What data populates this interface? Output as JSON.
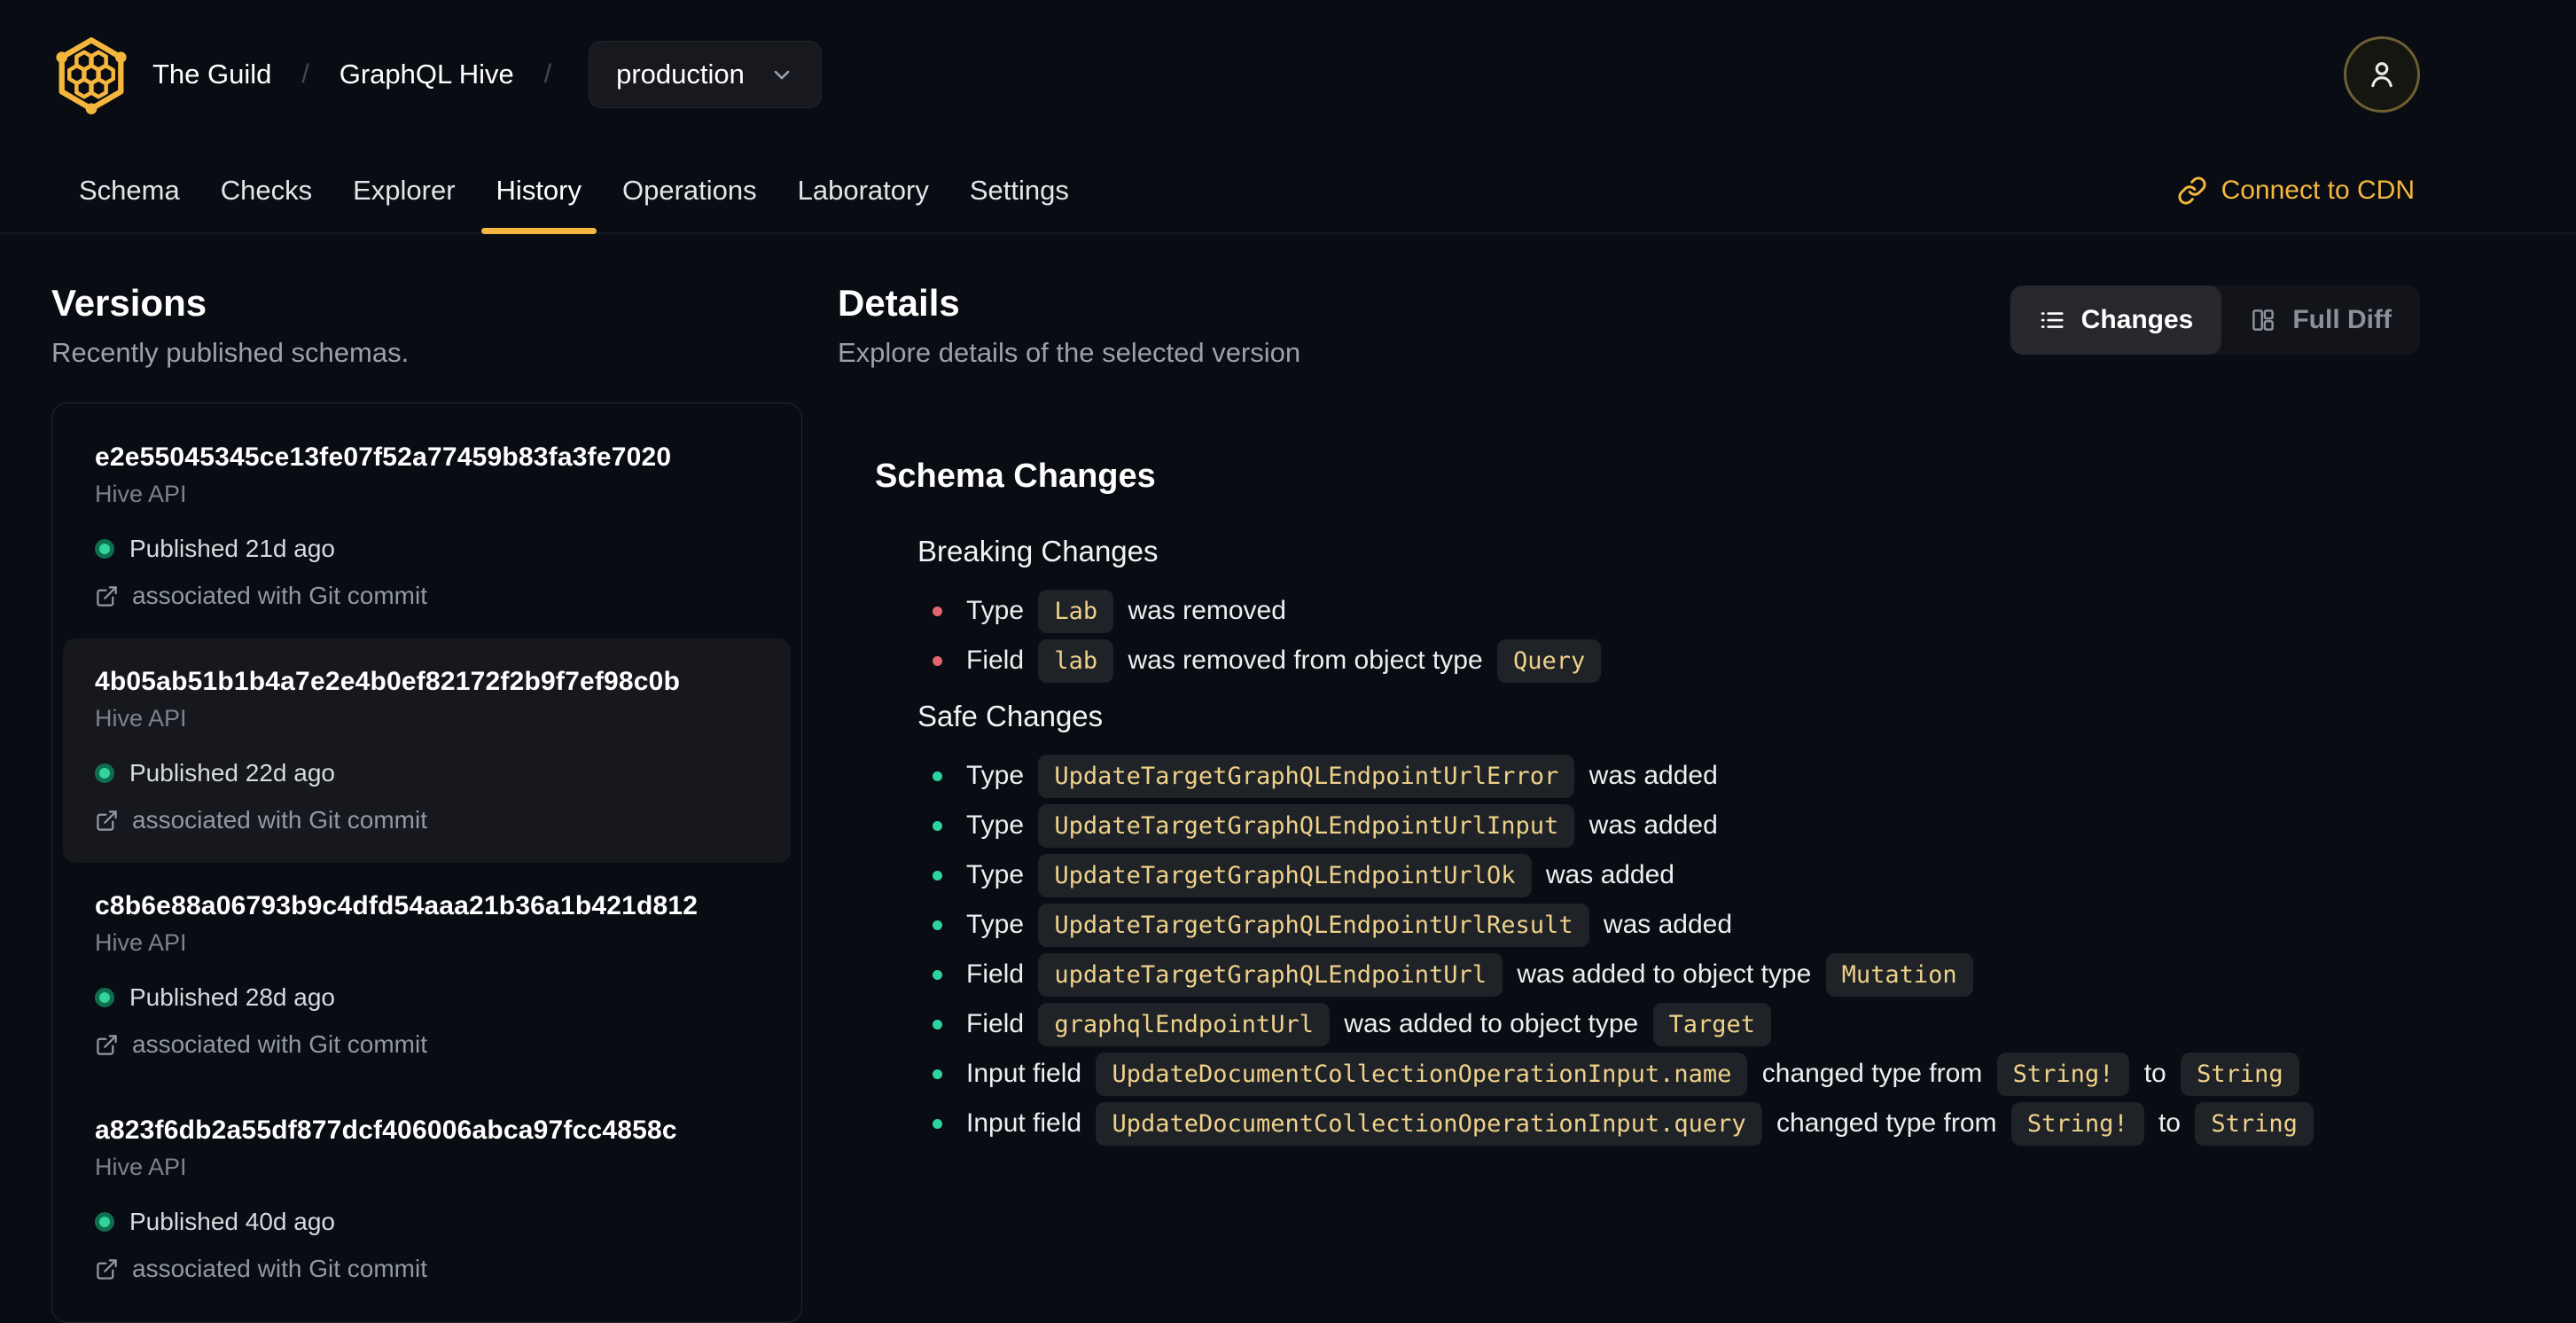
{
  "colors": {
    "accent": "#f4b740",
    "safe_change": "#2dd4a0",
    "breaking_change": "#e56570",
    "published_dot": "#34d399"
  },
  "header": {
    "org": "The Guild",
    "project": "GraphQL Hive",
    "separator": "/",
    "target_selector": {
      "value": "production"
    },
    "connect_cdn_label": "Connect to CDN",
    "tabs": [
      {
        "label": "Schema",
        "active": false
      },
      {
        "label": "Checks",
        "active": false
      },
      {
        "label": "Explorer",
        "active": false
      },
      {
        "label": "History",
        "active": true
      },
      {
        "label": "Operations",
        "active": false
      },
      {
        "label": "Laboratory",
        "active": false
      },
      {
        "label": "Settings",
        "active": false
      }
    ]
  },
  "versions_panel": {
    "title": "Versions",
    "subtitle": "Recently published schemas.",
    "items": [
      {
        "hash": "e2e55045345ce13fe07f52a77459b83fa3fe7020",
        "service": "Hive API",
        "published": "Published 21d ago",
        "git_label": "associated with Git commit",
        "selected": false
      },
      {
        "hash": "4b05ab51b1b4a7e2e4b0ef82172f2b9f7ef98c0b",
        "service": "Hive API",
        "published": "Published 22d ago",
        "git_label": "associated with Git commit",
        "selected": true
      },
      {
        "hash": "c8b6e88a06793b9c4dfd54aaa21b36a1b421d812",
        "service": "Hive API",
        "published": "Published 28d ago",
        "git_label": "associated with Git commit",
        "selected": false
      },
      {
        "hash": "a823f6db2a55df877dcf406006abca97fcc4858c",
        "service": "Hive API",
        "published": "Published 40d ago",
        "git_label": "associated with Git commit",
        "selected": false
      }
    ]
  },
  "details_panel": {
    "title": "Details",
    "subtitle": "Explore details of the selected version",
    "view_toggle": {
      "options": [
        {
          "label": "Changes",
          "active": true
        },
        {
          "label": "Full Diff",
          "active": false
        }
      ]
    },
    "schema_changes": {
      "title": "Schema Changes",
      "groups": [
        {
          "title": "Breaking Changes",
          "severity": "breaking",
          "items": [
            {
              "parts": [
                {
                  "text": "Type "
                },
                {
                  "code": "Lab"
                },
                {
                  "text": " was removed"
                }
              ]
            },
            {
              "parts": [
                {
                  "text": "Field "
                },
                {
                  "code": "lab"
                },
                {
                  "text": " was removed from object type "
                },
                {
                  "code": "Query"
                }
              ]
            }
          ]
        },
        {
          "title": "Safe Changes",
          "severity": "safe",
          "items": [
            {
              "parts": [
                {
                  "text": "Type "
                },
                {
                  "code": "UpdateTargetGraphQLEndpointUrlError"
                },
                {
                  "text": " was added"
                }
              ]
            },
            {
              "parts": [
                {
                  "text": "Type "
                },
                {
                  "code": "UpdateTargetGraphQLEndpointUrlInput"
                },
                {
                  "text": " was added"
                }
              ]
            },
            {
              "parts": [
                {
                  "text": "Type "
                },
                {
                  "code": "UpdateTargetGraphQLEndpointUrlOk"
                },
                {
                  "text": " was added"
                }
              ]
            },
            {
              "parts": [
                {
                  "text": "Type "
                },
                {
                  "code": "UpdateTargetGraphQLEndpointUrlResult"
                },
                {
                  "text": " was added"
                }
              ]
            },
            {
              "parts": [
                {
                  "text": "Field "
                },
                {
                  "code": "updateTargetGraphQLEndpointUrl"
                },
                {
                  "text": " was added to object type "
                },
                {
                  "code": "Mutation"
                }
              ]
            },
            {
              "parts": [
                {
                  "text": "Field "
                },
                {
                  "code": "graphqlEndpointUrl"
                },
                {
                  "text": " was added to object type "
                },
                {
                  "code": "Target"
                }
              ]
            },
            {
              "parts": [
                {
                  "text": "Input field "
                },
                {
                  "code": "UpdateDocumentCollectionOperationInput.name"
                },
                {
                  "text": " changed type from "
                },
                {
                  "code": "String!"
                },
                {
                  "text": " to "
                },
                {
                  "code": "String"
                }
              ]
            },
            {
              "parts": [
                {
                  "text": "Input field "
                },
                {
                  "code": "UpdateDocumentCollectionOperationInput.query"
                },
                {
                  "text": " changed type from "
                },
                {
                  "code": "String!"
                },
                {
                  "text": " to "
                },
                {
                  "code": "String"
                }
              ]
            }
          ]
        }
      ]
    }
  }
}
